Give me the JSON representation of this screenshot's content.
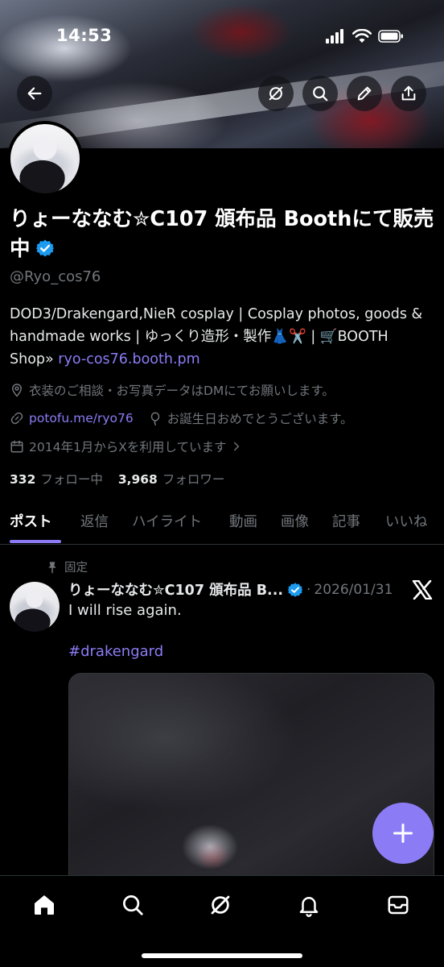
{
  "status_bar": {
    "time": "14:53"
  },
  "profile": {
    "name": "りょーななむ✮C107 頒布品 Boothにて販売中",
    "handle": "@Ryo_cos76",
    "bio_text": "DOD3/Drakengard,NieR cosplay | Cosplay photos, goods & handmade works | ゆっくり造形・製作👗✂️ | 🛒BOOTH Shop» ",
    "bio_link": "ryo-cos76.booth.pm",
    "location": "衣装のご相談・お写真データはDMにてお願いします。",
    "website": "potofu.me/ryo76",
    "birthday": "お誕生日おめでとうございます。",
    "joined": "2014年1月からXを利用しています",
    "following_count": "332",
    "following_label": "フォロー中",
    "followers_count": "3,968",
    "followers_label": "フォロワー"
  },
  "tabs": [
    "ポスト",
    "返信",
    "ハイライト",
    "動画",
    "画像",
    "記事",
    "いいね"
  ],
  "pinned_post": {
    "pinned_label": "固定",
    "author": "りょーななむ✮C107 頒布品 B...",
    "date": "2026/01/31",
    "text": "I will rise again.",
    "hashtag": "#drakengard"
  },
  "colors": {
    "accent": "#8b7cf6",
    "verified": "#1d9bf0",
    "muted": "#71767b",
    "background": "#000000"
  },
  "icons": {
    "header": [
      "back-arrow-icon",
      "grok-icon",
      "search-icon",
      "edit-icon",
      "share-icon"
    ],
    "bottom_nav": [
      "home-icon",
      "search-icon",
      "grok-icon",
      "notifications-icon",
      "messages-icon"
    ],
    "fab": "plus-icon"
  }
}
